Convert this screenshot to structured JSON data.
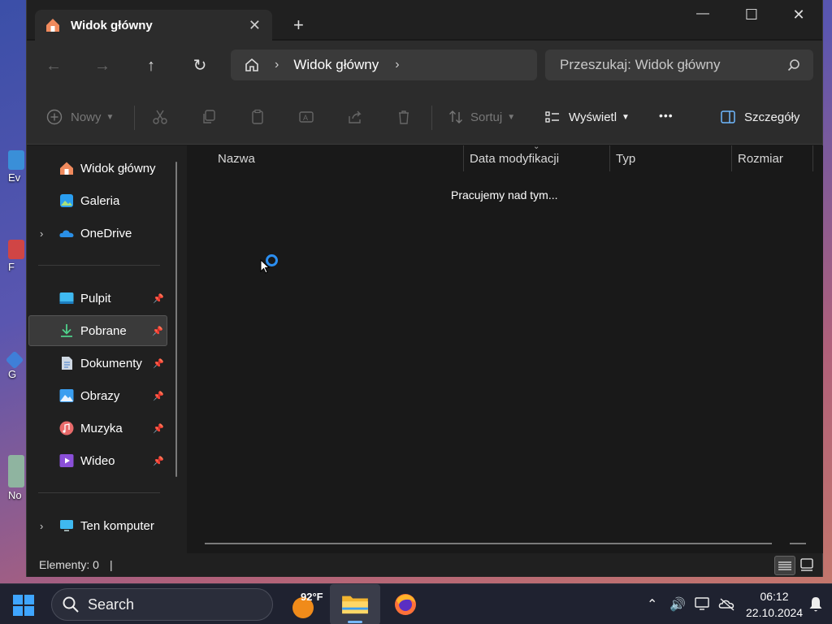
{
  "desktop": {
    "icon_labels": [
      "Ev",
      "F",
      "G",
      "No"
    ]
  },
  "window": {
    "tab_title": "Widok główny",
    "tab_close": "✕",
    "new_tab": "+",
    "minimize": "—",
    "maximize": "☐",
    "close": "✕"
  },
  "nav": {
    "back": "←",
    "forward": "→",
    "up": "↑",
    "refresh": "↻",
    "breadcrumb": "Widok główny",
    "breadcrumb_sep": "›",
    "breadcrumb_trailing": "›",
    "search_placeholder": "Przeszukaj: Widok główny"
  },
  "commands": {
    "new_label": "Nowy",
    "sort_label": "Sortuj",
    "view_label": "Wyświetl",
    "more_label": "•••",
    "details_label": "Szczegóły"
  },
  "sidebar": {
    "items": [
      {
        "label": "Widok główny",
        "icon": "home-icon",
        "pinned": false
      },
      {
        "label": "Galeria",
        "icon": "gallery-icon",
        "pinned": false
      },
      {
        "label": "OneDrive",
        "icon": "cloud-icon",
        "pinned": false,
        "expandable": true
      },
      {
        "label": "Pulpit",
        "icon": "desktop-icon",
        "pinned": true
      },
      {
        "label": "Pobrane",
        "icon": "download-icon",
        "pinned": true,
        "selected": true
      },
      {
        "label": "Dokumenty",
        "icon": "document-icon",
        "pinned": true
      },
      {
        "label": "Obrazy",
        "icon": "pictures-icon",
        "pinned": true
      },
      {
        "label": "Muzyka",
        "icon": "music-icon",
        "pinned": true
      },
      {
        "label": "Wideo",
        "icon": "video-icon",
        "pinned": true
      },
      {
        "label": "Ten komputer",
        "icon": "computer-icon",
        "pinned": false,
        "expandable": true
      }
    ],
    "pin_glyph": "📌",
    "expand_glyph": "›"
  },
  "content": {
    "columns": [
      "Nazwa",
      "Data modyfikacji",
      "Typ",
      "Rozmiar"
    ],
    "loading_text": "Pracujemy nad tym..."
  },
  "status": {
    "item_count": "Elementy: 0",
    "caret": "|"
  },
  "taskbar": {
    "search_label": "Search",
    "weather_temp": "92°F",
    "time": "06:12",
    "date": "22.10.2024"
  },
  "colors": {
    "accent": "#2b8ef0",
    "window_bg": "#191919",
    "chrome_bg": "#2c2c2c"
  }
}
